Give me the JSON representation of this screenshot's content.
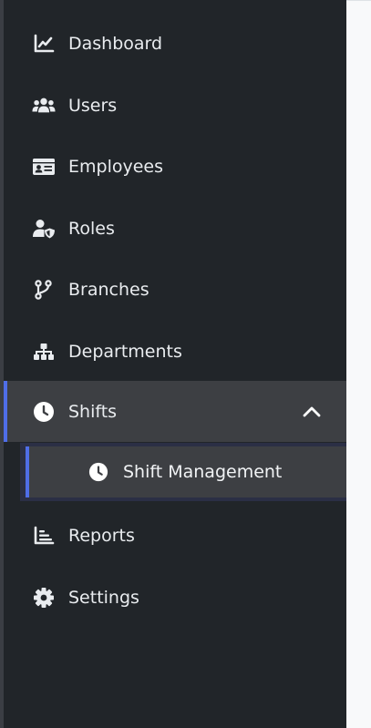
{
  "colors": {
    "sidebar_bg": "#212529",
    "active_bg": "#3d3f43",
    "accent": "#4f6ee8",
    "text": "#e9ecef"
  },
  "sidebar": {
    "items": [
      {
        "label": "Dashboard",
        "icon": "chart-line-icon"
      },
      {
        "label": "Users",
        "icon": "users-icon"
      },
      {
        "label": "Employees",
        "icon": "id-card-icon"
      },
      {
        "label": "Roles",
        "icon": "user-shield-icon"
      },
      {
        "label": "Branches",
        "icon": "code-branch-icon"
      },
      {
        "label": "Departments",
        "icon": "sitemap-icon"
      },
      {
        "label": "Shifts",
        "icon": "clock-icon",
        "expanded": true
      },
      {
        "label": "Reports",
        "icon": "chart-bar-icon"
      },
      {
        "label": "Settings",
        "icon": "gear-icon"
      }
    ],
    "shifts_submenu": [
      {
        "label": "Shift Management",
        "icon": "clock-icon",
        "active": true
      }
    ]
  }
}
